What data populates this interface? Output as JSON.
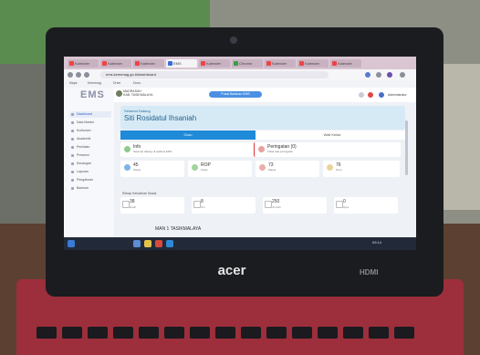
{
  "browser": {
    "tabs": [
      {
        "label": "Kalender"
      },
      {
        "label": "Kalender"
      },
      {
        "label": "Kalender"
      },
      {
        "label": "EMS"
      },
      {
        "label": "Kalender"
      },
      {
        "label": "Chrome"
      },
      {
        "label": "Kalender"
      },
      {
        "label": "Kalender"
      },
      {
        "label": "Kalender"
      }
    ],
    "address": "ems.kemenag.go.id/dashboard"
  },
  "bookmarks": [
    {
      "label": "Maps"
    },
    {
      "label": "Kemenag"
    },
    {
      "label": "Drive"
    },
    {
      "label": "Docs"
    }
  ],
  "app": {
    "brand": "EMS",
    "school_name": "MADRASAH",
    "school_sub": "KAB. TASIKMALAYA",
    "announcement": "Pusat Bantuan EMS",
    "username": "Administrator"
  },
  "sidebar": {
    "items": [
      {
        "label": "Dashboard"
      },
      {
        "label": "Data Master"
      },
      {
        "label": "Kurikulum"
      },
      {
        "label": "Akademik"
      },
      {
        "label": "Penilaian"
      },
      {
        "label": "Presensi"
      },
      {
        "label": "Keuangan"
      },
      {
        "label": "Laporan"
      },
      {
        "label": "Pengaturan"
      },
      {
        "label": "Bantuan"
      }
    ]
  },
  "welcome": {
    "small": "Selamat Datang",
    "title": "Siti Rosidatul Ihsaniah"
  },
  "view_tabs": {
    "active": "Guru",
    "inactive": "Wali Kelas"
  },
  "cards": {
    "info": {
      "value": "Info",
      "label": "Selamat datang di aplikasi EMS"
    },
    "peringatan": {
      "value": "Peringatan (0)",
      "label": "Tidak ada peringatan"
    },
    "siswa": {
      "value": "45",
      "label": "Siswa"
    },
    "kelas": {
      "value": "ROP",
      "label": "Kelas"
    },
    "mapel": {
      "value": "73",
      "label": "Mapel"
    },
    "guru": {
      "value": "76",
      "label": "Guru"
    }
  },
  "section_label": "Rekap Kehadiran Siswa",
  "stats": [
    {
      "value": "38",
      "label": "Hadir"
    },
    {
      "value": "8",
      "label": "Izin"
    },
    {
      "value": "250",
      "label": "Jumlah"
    },
    {
      "value": "0",
      "label": "Alpa"
    }
  ],
  "bottom_title": "MAN 1 TASIKMALAYA",
  "taskbar": {
    "clock": "09:14"
  },
  "laptop": {
    "logo": "acer",
    "port_label": "HDMI"
  },
  "colors": {
    "accent": "#1f8ad8",
    "banner": "#d6eaf6",
    "laptop_base": "#9d2e3b"
  }
}
